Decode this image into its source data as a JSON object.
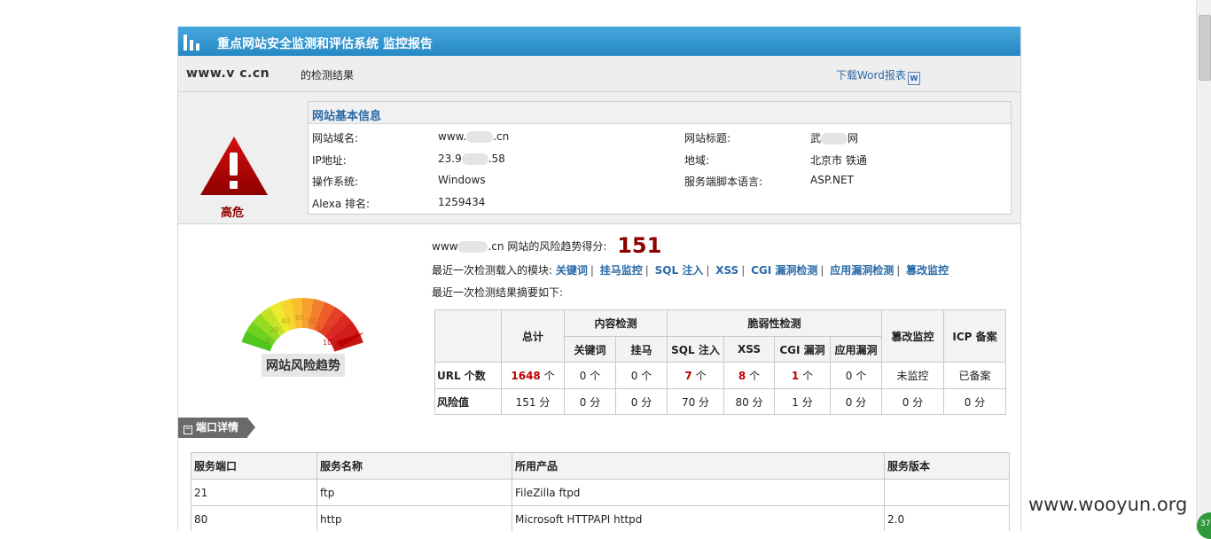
{
  "header": {
    "title": "重点网站安全监测和评估系统  监控报告",
    "domain": "www.v   c.cn",
    "result_label": "的检测结果",
    "download_label": "下载Word报表",
    "download_icon": "word-doc-icon"
  },
  "basic_info": {
    "section_title": "网站基本信息",
    "risk_level": "高危",
    "rows": [
      {
        "l1": "网站域名:",
        "v1": "www.",
        "v1b": ".cn",
        "l2": "网站标题:",
        "v2": "武",
        "v2b": "网"
      },
      {
        "l1": "IP地址:",
        "v1": "23.9",
        "v1b": ".58",
        "l2": "地域:",
        "v2": "北京市 铁通",
        "v2b": ""
      },
      {
        "l1": "操作系统:",
        "v1": "Windows",
        "v1b": "",
        "l2": "服务端脚本语言:",
        "v2": "ASP.NET",
        "v2b": ""
      },
      {
        "l1": "Alexa 排名:",
        "v1": "1259434",
        "v1b": "",
        "l2": "",
        "v2": "",
        "v2b": ""
      }
    ]
  },
  "trend": {
    "domain": "www",
    "domain_tail": ".cn",
    "score_label": "网站的风险趋势得分:",
    "score": "151",
    "modules_label": "最近一次检测载入的模块:",
    "modules": [
      "关键词",
      "挂马监控",
      "SQL 注入",
      "XSS",
      "CGI 漏洞检测",
      "应用漏洞检测",
      "篡改监控"
    ],
    "summary_label": "最近一次检测结果摘要如下:",
    "gauge_caption": "网站风险趋势",
    "gauge_ticks": [
      "0",
      "20",
      "40",
      "60",
      "80",
      "100",
      "100+"
    ],
    "gauge_value": 151
  },
  "stats_table": {
    "h_total": "总计",
    "h_content": "内容检测",
    "h_vuln": "脆弱性检测",
    "h_tamper": "篡改监控",
    "h_icp": "ICP 备案",
    "sub": [
      "关键词",
      "挂马",
      "SQL 注入",
      "XSS",
      "CGI 漏洞",
      "应用漏洞"
    ],
    "row1": {
      "label": "URL 个数",
      "total_n": "1648",
      "unit": "个",
      "kw": "0 个",
      "trojan": "0 个",
      "sql_n": "7",
      "xss_n": "8",
      "cgi_n": "1",
      "app": "0 个",
      "tamper": "未监控",
      "icp": "已备案"
    },
    "row2": {
      "label": "风险值",
      "total": "151 分",
      "kw": "0 分",
      "trojan": "0 分",
      "sql": "70 分",
      "xss": "80 分",
      "cgi": "1 分",
      "app": "0 分",
      "tamper": "0 分",
      "icp": "0 分"
    }
  },
  "ports": {
    "tab_label": "端口详情",
    "tab_icon": "collapse-minus-icon",
    "headers": [
      "服务端口",
      "服务名称",
      "所用产品",
      "服务版本"
    ],
    "rows": [
      [
        "21",
        "ftp",
        "FileZilla ftpd",
        ""
      ],
      [
        "80",
        "http",
        "Microsoft HTTPAPI httpd",
        "2.0"
      ]
    ]
  },
  "overlay": {
    "watermark": "www.wooyun.org",
    "badge": "37"
  },
  "colors": {
    "title_bar": "#2f94cf",
    "danger": "#b30000",
    "link": "#2b6aa8",
    "score": "#8b0000"
  }
}
